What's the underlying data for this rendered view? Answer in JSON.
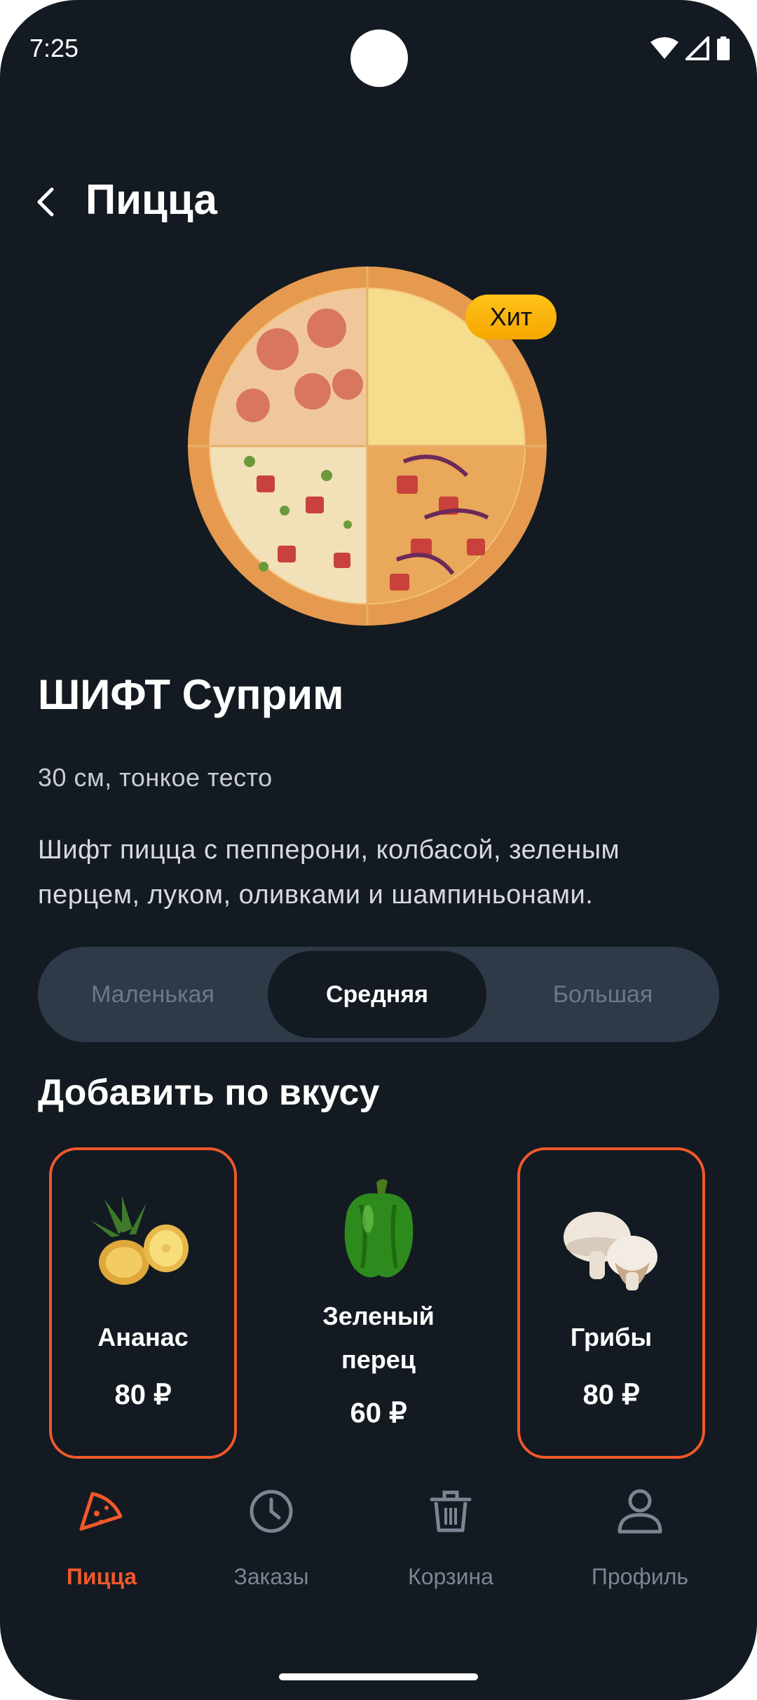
{
  "status": {
    "time": "7:25"
  },
  "header": {
    "title": "Пицца"
  },
  "product": {
    "badge": "Хит",
    "name": "ШИФТ Суприм",
    "size_info": "30 см, тонкое тесто",
    "description": "Шифт пицца с пепперони, колбасой, зеленым перцем, луком, оливками и шампиньонами."
  },
  "sizes": {
    "options": [
      "Маленькая",
      "Средняя",
      "Большая"
    ],
    "selected": "Средняя"
  },
  "toppings": {
    "title": "Добавить по вкусу",
    "items": [
      {
        "name": "Ананас",
        "price": "80 ₽",
        "selected": true,
        "icon": "pineapple-icon"
      },
      {
        "name": "Зеленый перец",
        "price": "60 ₽",
        "selected": false,
        "icon": "green-pepper-icon"
      },
      {
        "name": "Грибы",
        "price": "80 ₽",
        "selected": true,
        "icon": "mushroom-icon"
      }
    ]
  },
  "nav": {
    "items": [
      {
        "label": "Пицца",
        "icon": "pizza-icon",
        "active": true
      },
      {
        "label": "Заказы",
        "icon": "clock-icon",
        "active": false
      },
      {
        "label": "Корзина",
        "icon": "trash-icon",
        "active": false
      },
      {
        "label": "Профиль",
        "icon": "user-icon",
        "active": false
      }
    ]
  },
  "colors": {
    "accent": "#f0582a",
    "background": "#131a22",
    "segment": "#2f3a49",
    "badge": "#ffc21a"
  }
}
